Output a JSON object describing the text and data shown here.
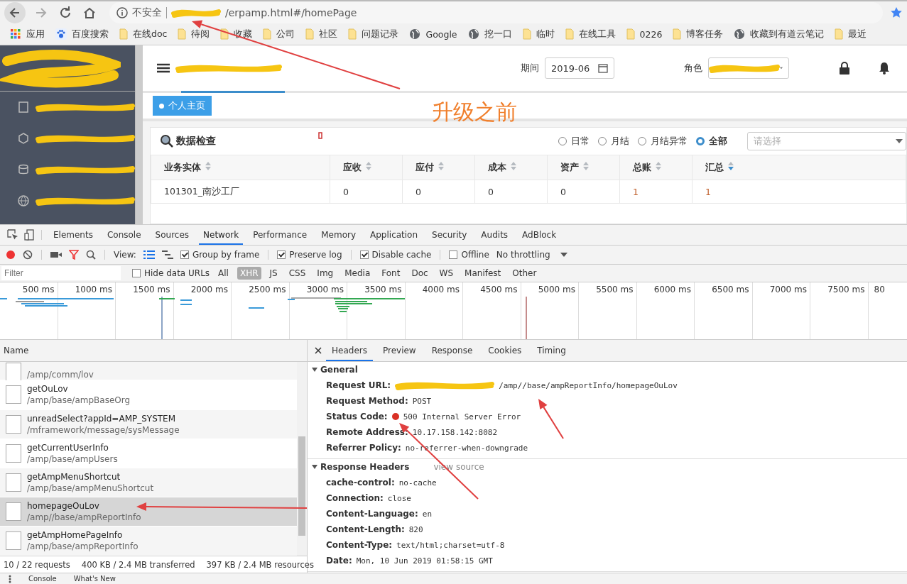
{
  "browser": {
    "security_label": "不安全",
    "url": "/erpamp.html#/homePage",
    "bookmarks": [
      {
        "label": "应用",
        "kind": "apps"
      },
      {
        "label": "百度搜索",
        "kind": "paw"
      },
      {
        "label": "在线doc",
        "kind": "folder"
      },
      {
        "label": "待阅",
        "kind": "folder"
      },
      {
        "label": "收藏",
        "kind": "folder"
      },
      {
        "label": "公司",
        "kind": "folder"
      },
      {
        "label": "社区",
        "kind": "folder"
      },
      {
        "label": "问题记录",
        "kind": "folder"
      },
      {
        "label": "Google",
        "kind": "globe"
      },
      {
        "label": "挖一口",
        "kind": "globe"
      },
      {
        "label": "临时",
        "kind": "folder"
      },
      {
        "label": "在线工具",
        "kind": "folder"
      },
      {
        "label": "0226",
        "kind": "folder"
      },
      {
        "label": "博客任务",
        "kind": "folder"
      },
      {
        "label": "收藏到有道云笔记",
        "kind": "globe"
      },
      {
        "label": "最近",
        "kind": "folder"
      }
    ]
  },
  "app": {
    "header": {
      "period_label": "期间",
      "period_value": "2019-06",
      "role_label": "角色"
    },
    "nav_tabs": [
      {
        "label": "个人主页",
        "selected": true
      }
    ],
    "annotation": "升级之前",
    "panel": {
      "title": "数据检查",
      "filters": [
        {
          "label": "日常",
          "selected": false
        },
        {
          "label": "月结",
          "selected": false
        },
        {
          "label": "月结异常",
          "selected": false
        },
        {
          "label": "全部",
          "selected": true
        }
      ],
      "select_placeholder": "请选择",
      "columns": [
        {
          "label": "业务实体",
          "sorted": false
        },
        {
          "label": "应收",
          "sorted": false
        },
        {
          "label": "应付",
          "sorted": false
        },
        {
          "label": "成本",
          "sorted": false
        },
        {
          "label": "资产",
          "sorted": false
        },
        {
          "label": "总账",
          "sorted": false
        },
        {
          "label": "汇总",
          "sorted": true
        }
      ],
      "rows": [
        [
          {
            "text": "101301_南沙工厂",
            "flagged": false
          },
          {
            "text": "0",
            "flagged": false
          },
          {
            "text": "0",
            "flagged": false
          },
          {
            "text": "0",
            "flagged": false
          },
          {
            "text": "0",
            "flagged": false
          },
          {
            "text": "1",
            "flagged": true
          },
          {
            "text": "1",
            "flagged": true
          }
        ]
      ]
    }
  },
  "devtools": {
    "tabs": [
      {
        "label": "Elements",
        "selected": false
      },
      {
        "label": "Console",
        "selected": false
      },
      {
        "label": "Sources",
        "selected": false
      },
      {
        "label": "Network",
        "selected": true
      },
      {
        "label": "Performance",
        "selected": false
      },
      {
        "label": "Memory",
        "selected": false
      },
      {
        "label": "Application",
        "selected": false
      },
      {
        "label": "Security",
        "selected": false
      },
      {
        "label": "Audits",
        "selected": false
      },
      {
        "label": "AdBlock",
        "selected": false
      }
    ],
    "view_label": "View:",
    "checkboxes": [
      {
        "label": "Group by frame",
        "checked": true
      },
      {
        "label": "Preserve log",
        "checked": true
      },
      {
        "label": "Disable cache",
        "checked": true
      },
      {
        "label": "Offline",
        "checked": false
      }
    ],
    "throttling": "No throttling",
    "filter_placeholder": "Filter",
    "hide_data_urls": {
      "label": "Hide data URLs",
      "checked": false
    },
    "types": [
      {
        "label": "All",
        "selected": false
      },
      {
        "label": "XHR",
        "selected": true
      },
      {
        "label": "JS",
        "selected": false
      },
      {
        "label": "CSS",
        "selected": false
      },
      {
        "label": "Img",
        "selected": false
      },
      {
        "label": "Media",
        "selected": false
      },
      {
        "label": "Font",
        "selected": false
      },
      {
        "label": "Doc",
        "selected": false
      },
      {
        "label": "WS",
        "selected": false
      },
      {
        "label": "Manifest",
        "selected": false
      },
      {
        "label": "Other",
        "selected": false
      }
    ],
    "timeline_ticks": [
      "500 ms",
      "1000 ms",
      "1500 ms",
      "2000 ms",
      "2500 ms",
      "3000 ms",
      "3500 ms",
      "4000 ms",
      "4500 ms",
      "5000 ms",
      "5500 ms",
      "6000 ms",
      "6500 ms",
      "7000 ms",
      "7500 ms",
      "80"
    ],
    "name_header": "Name",
    "requests": [
      {
        "path": "/amp/comm/lov",
        "selected": false
      },
      {
        "name": "getOuLov",
        "path": "/amp/base/ampBaseOrg",
        "selected": false
      },
      {
        "name": "unreadSelect?appId=AMP_SYSTEM",
        "path": "/mframework/message/sysMessage",
        "selected": false
      },
      {
        "name": "getCurrentUserInfo",
        "path": "/amp/base/ampUsers",
        "selected": false
      },
      {
        "name": "getAmpMenuShortcut",
        "path": "/amp/base/ampMenuShortcut",
        "selected": false
      },
      {
        "name": "homepageOuLov",
        "path": "/amp//base/ampReportInfo",
        "selected": true
      },
      {
        "name": "getAmpHomePageInfo",
        "path": "/amp/base/ampReportInfo",
        "selected": false
      }
    ],
    "summary": [
      "10 / 22 requests",
      "400 KB / 2.4 MB transferred",
      "397 KB / 2.4 MB resources"
    ],
    "detail_tabs": [
      {
        "label": "Headers",
        "selected": true
      },
      {
        "label": "Preview",
        "selected": false
      },
      {
        "label": "Response",
        "selected": false
      },
      {
        "label": "Cookies",
        "selected": false
      },
      {
        "label": "Timing",
        "selected": false
      }
    ],
    "general": {
      "title": "General",
      "expanded": true,
      "rows": [
        {
          "key": "Request URL:",
          "value": "/amp//base/ampReportInfo/homepageOuLov",
          "kind": "redacted"
        },
        {
          "key": "Request Method:",
          "value": "POST",
          "kind": "plain"
        },
        {
          "key": "Status Code:",
          "value": "500 Internal Server Error",
          "kind": "status"
        },
        {
          "key": "Remote Address:",
          "value": "10.17.158.142:8082",
          "kind": "plain"
        },
        {
          "key": "Referrer Policy:",
          "value": "no-referrer-when-downgrade",
          "kind": "plain"
        }
      ]
    },
    "response_headers": {
      "title": "Response Headers",
      "expanded": true,
      "link": "view source",
      "rows": [
        {
          "key": "cache-control:",
          "value": "no-cache"
        },
        {
          "key": "Connection:",
          "value": "close"
        },
        {
          "key": "Content-Language:",
          "value": "en"
        },
        {
          "key": "Content-Length:",
          "value": "820"
        },
        {
          "key": "Content-Type:",
          "value": "text/html;charset=utf-8"
        },
        {
          "key": "Date:",
          "value": "Mon, 10 Jun 2019 01:58:15 GMT"
        }
      ]
    },
    "drawer_tabs": [
      "Console",
      "What's New"
    ]
  }
}
